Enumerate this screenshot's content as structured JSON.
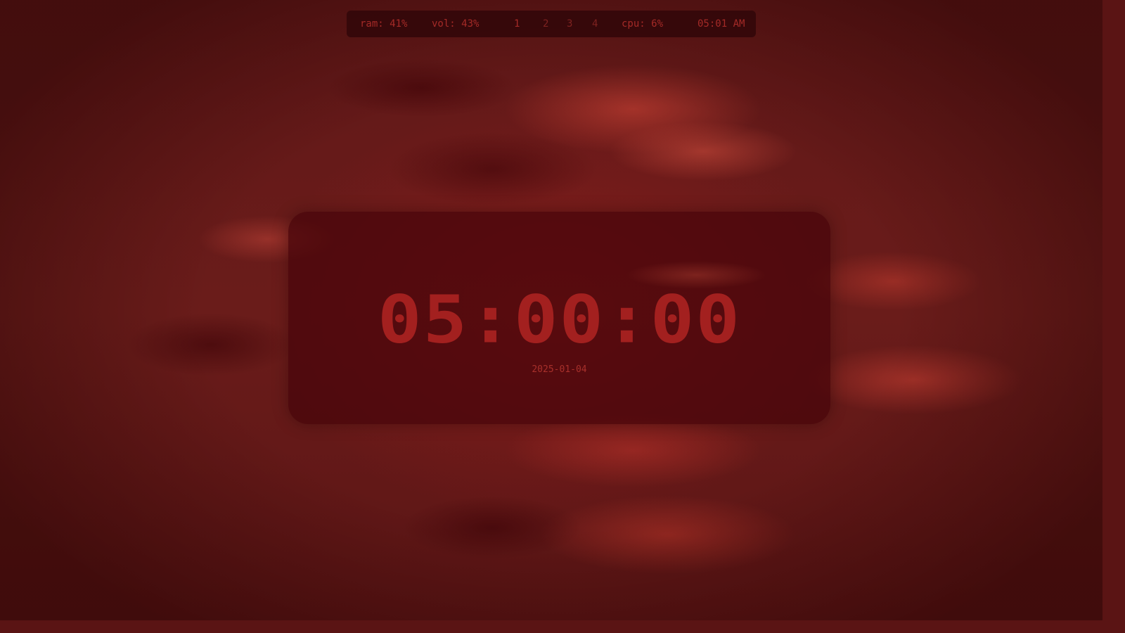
{
  "statusbar": {
    "ram": "ram: 41%",
    "volume": "vol: 43%",
    "workspaces": [
      "1",
      "2",
      "3",
      "4"
    ],
    "active_workspace": "1",
    "cpu": "cpu: 6%",
    "clock": "05:01 AM"
  },
  "clock_widget": {
    "time": "05:00:00",
    "date": "2025-01-04"
  },
  "colors": {
    "text_accent": "#a52a27",
    "panel_bg": "#46040a",
    "wallpaper_base": "#621818"
  }
}
